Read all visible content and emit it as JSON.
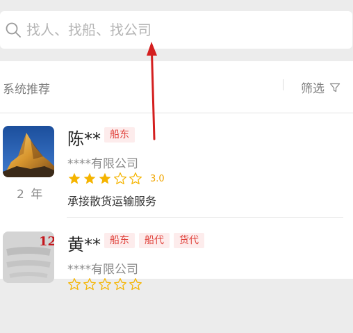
{
  "search": {
    "placeholder": "找人、找船、找公司",
    "icon": "search-icon"
  },
  "filter_bar": {
    "section_title": "系统推荐",
    "filter_label": "筛选",
    "filter_icon": "funnel-icon"
  },
  "colors": {
    "tag_text": "#e0453e",
    "tag_bg": "#fdecec",
    "star": "#f5b400",
    "rating_text": "#f0a500",
    "arrow": "#d41f1f"
  },
  "cards": [
    {
      "name": "陈**",
      "tags": [
        "船东"
      ],
      "company": "****有限公司",
      "rating": 3.0,
      "rating_label": "3.0",
      "years": "2 年",
      "service": "承接散货运输服务",
      "avatar": "mountain-photo"
    },
    {
      "name": "黄**",
      "tags": [
        "船东",
        "船代",
        "货代"
      ],
      "company": "****有限公司",
      "rating": 0,
      "avatar": "century-logo"
    }
  ]
}
